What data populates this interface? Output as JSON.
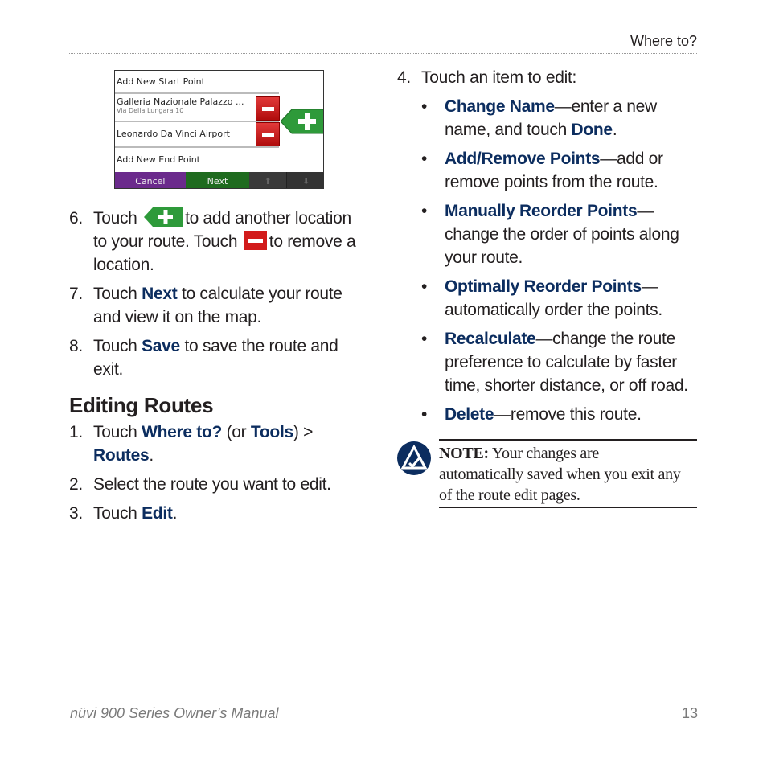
{
  "header": {
    "section": "Where to?"
  },
  "screen": {
    "rows": [
      {
        "label": "Add New Start Point",
        "sub": ""
      },
      {
        "label": "Galleria Nazionale Palazzo ...",
        "sub": "Via Della Lungara 10"
      },
      {
        "label": "Leonardo Da Vinci Airport",
        "sub": ""
      },
      {
        "label": "Add New End Point",
        "sub": ""
      }
    ],
    "cancel_label": "Cancel",
    "next_label": "Next",
    "colors": {
      "cancel": "#6b2a8c",
      "next": "#1f6b1f",
      "minus": "#cc1a1a",
      "plus": "#2e9a3a"
    }
  },
  "left_steps": {
    "step6": {
      "num": "6.",
      "a": "Touch",
      "b": "to add another location",
      "c": "to your route. Touch",
      "d": "to remove a",
      "e": "location."
    },
    "step7": {
      "num": "7.",
      "a": "Touch",
      "kw": "Next",
      "b": "to calculate your route",
      "c": "and view it on the map."
    },
    "step8": {
      "num": "8.",
      "a": "Touch",
      "kw": "Save",
      "b": "to save the route and",
      "c": "exit."
    }
  },
  "editing": {
    "heading": "Editing Routes",
    "step1": {
      "num": "1.",
      "a": "Touch",
      "kw1": "Where to?",
      "b": "(or",
      "kw2": "Tools",
      "c": ") >",
      "kw3": "Routes",
      "d": "."
    },
    "step2": {
      "num": "2.",
      "text": "Select the route you want to edit."
    },
    "step3": {
      "num": "3.",
      "a": "Touch",
      "kw": "Edit",
      "b": "."
    }
  },
  "right": {
    "step4": {
      "num": "4.",
      "text": "Touch an item to edit:"
    },
    "bullets": [
      {
        "kw": "Change Name",
        "l1": "—enter a new",
        "l2a": "name, and touch",
        "l2kw": "Done",
        "l2b": "."
      },
      {
        "kw": "Add/Remove Points",
        "l1": "—add or",
        "l2": "remove points from the route."
      },
      {
        "kw": "Manually Reorder Points",
        "l1": "—",
        "l2": "change the order of points along",
        "l3": "your route."
      },
      {
        "kw": "Optimally Reorder Points",
        "l1": "—",
        "l2": "automatically order the points."
      },
      {
        "kw": "Recalculate",
        "l1": "—change the route",
        "l2": "preference to calculate by faster",
        "l3": "time, shorter distance, or off road."
      },
      {
        "kw": "Delete",
        "l1": "—remove this route."
      }
    ],
    "bullet_char": "•",
    "note": {
      "label": "NOTE:",
      "l1": "Your changes are",
      "l2": "automatically saved when you exit any",
      "l3": "of the route edit pages."
    }
  },
  "footer": {
    "manual_title": "nüvi 900 Series Owner’s Manual",
    "page_number": "13"
  }
}
